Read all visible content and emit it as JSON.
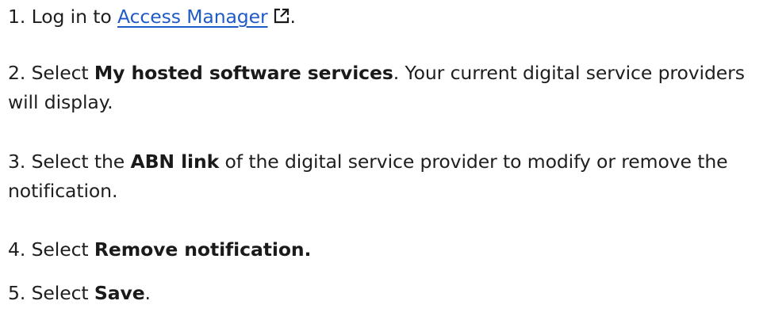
{
  "steps": [
    {
      "number": "1.",
      "pre": "Log in to",
      "link_text": "Access Manager",
      "post": "."
    },
    {
      "number": "2.",
      "pre": "Select",
      "bold": "My hosted software services",
      "post": ". Your current digital service providers will display."
    },
    {
      "number": "3.",
      "pre": "Select the",
      "bold": "ABN link",
      "post": "of the digital service provider to modify or remove the notification."
    },
    {
      "number": "4.",
      "pre": "Select",
      "bold": "Remove notification."
    },
    {
      "number": "5.",
      "pre": "Select",
      "bold": "Save",
      "post": "."
    }
  ],
  "icons": {
    "external_link": "external-link-icon"
  },
  "colors": {
    "text": "#1e1e1e",
    "link": "#1f5bc7"
  }
}
